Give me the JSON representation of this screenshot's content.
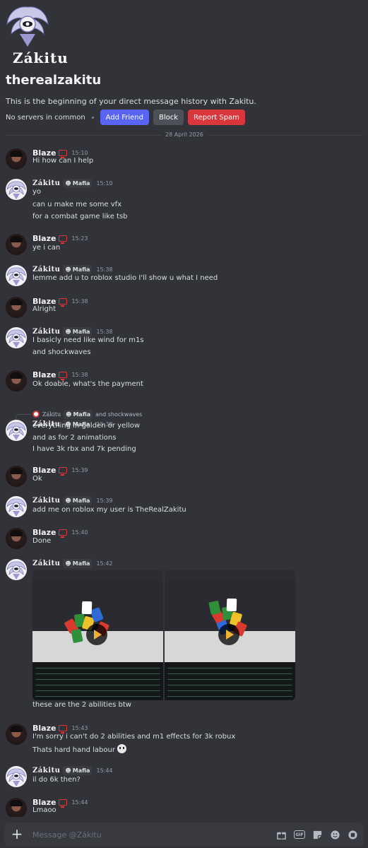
{
  "profile": {
    "display_name": "Zákitu",
    "username": "therealzakitu",
    "intro": "This is the beginning of your direct message history with Zakitu.",
    "servers": "No servers in common",
    "add_friend": "Add Friend",
    "block": "Block",
    "report_spam": "Report Spam"
  },
  "date_divider": "28 April 2026",
  "guild_tag": "Mafia",
  "messages": [
    {
      "author": "Blaze",
      "time": "15:10",
      "lines": [
        "Hi how can I help"
      ]
    },
    {
      "author": "Zákitu",
      "time": "15:10",
      "lines": [
        "yo",
        "can u make me some vfx",
        "for a combat game like tsb"
      ]
    },
    {
      "author": "Blaze",
      "time": "15:23",
      "lines": [
        "ye i can"
      ]
    },
    {
      "author": "Zákitu",
      "time": "15:38",
      "lines": [
        "lemme add u to roblox studio I'll show u what I need"
      ]
    },
    {
      "author": "Blaze",
      "time": "15:38",
      "lines": [
        "Alright"
      ]
    },
    {
      "author": "Zákitu",
      "time": "15:38",
      "lines": [
        "I basicly need like wind for m1s",
        "and shockwaves"
      ]
    },
    {
      "author": "Blaze",
      "time": "15:38",
      "lines": [
        "Ok doable, what's the payment"
      ]
    },
    {
      "author": "Zákitu",
      "time": "15:38",
      "reply": {
        "name": "Zákitu",
        "text": "and shockwaves"
      },
      "lines": [
        "everything in golden or yellow",
        "and as for 2 animations",
        "I have 3k rbx and 7k pending"
      ]
    },
    {
      "author": "Blaze",
      "time": "15:39",
      "lines": [
        "Ok"
      ]
    },
    {
      "author": "Zákitu",
      "time": "15:39",
      "lines": [
        "add me on roblox my user is TheRealZakitu"
      ]
    },
    {
      "author": "Blaze",
      "time": "15:40",
      "lines": [
        "Done"
      ]
    },
    {
      "author": "Zákitu",
      "time": "15:42",
      "lines": [
        "these are the 2 abilities btw"
      ]
    },
    {
      "author": "Blaze",
      "time": "15:43",
      "lines": [
        "I'm sorry i can't do 2 abilities and m1 effects for 3k robux",
        "Thats hard hand labour"
      ]
    },
    {
      "author": "Zákitu",
      "time": "15:44",
      "lines": [
        "il do 6k then?"
      ]
    },
    {
      "author": "Blaze",
      "time": "15:44",
      "lines": [
        "Lmaoo"
      ]
    }
  ],
  "composer": {
    "placeholder": "Message @Zákitu"
  },
  "icons": {
    "plus": "plus-icon",
    "gift": "gift-icon",
    "gif": "gif-icon",
    "sticker": "sticker-icon",
    "emoji": "emoji-icon",
    "apps": "apps-icon"
  }
}
